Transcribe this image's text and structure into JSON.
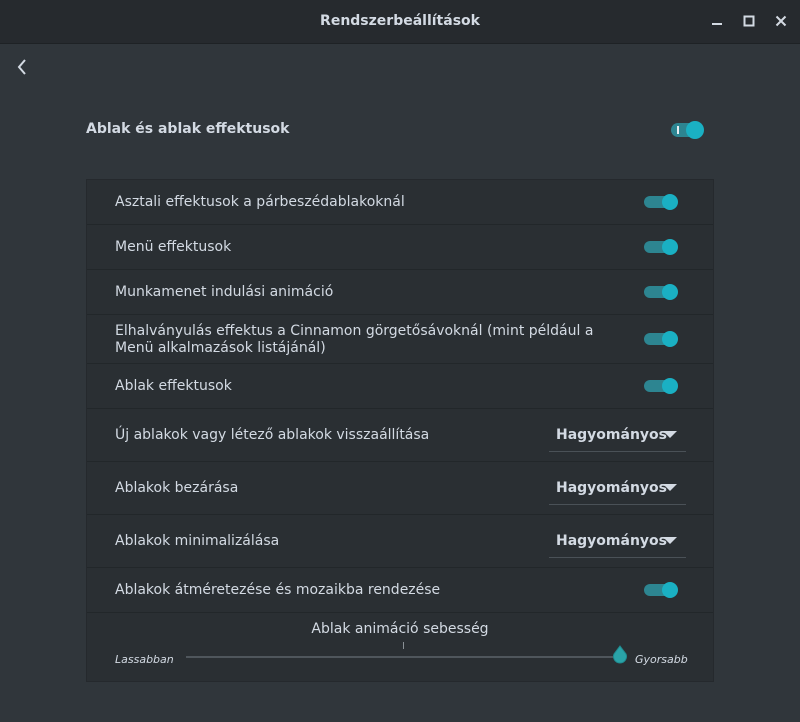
{
  "window": {
    "title": "Rendszerbeállítások"
  },
  "section": {
    "title": "Ablak és ablak effektusok",
    "enabled": true
  },
  "rows": [
    {
      "label": "Asztali effektusok a párbeszédablakoknál",
      "type": "switch",
      "on": true
    },
    {
      "label": "Menü effektusok",
      "type": "switch",
      "on": true
    },
    {
      "label": "Munkamenet indulási animáció",
      "type": "switch",
      "on": true
    },
    {
      "label": "Elhalványulás effektus a Cinnamon görgetősávoknál (mint például a Menü alkalmazások listájánál)",
      "type": "switch",
      "on": true
    },
    {
      "label": "Ablak effektusok",
      "type": "switch",
      "on": true
    },
    {
      "label": "Új ablakok vagy létező ablakok visszaállítása",
      "type": "dropdown",
      "value": "Hagyományos"
    },
    {
      "label": "Ablakok bezárása",
      "type": "dropdown",
      "value": "Hagyományos"
    },
    {
      "label": "Ablakok minimalizálása",
      "type": "dropdown",
      "value": "Hagyományos"
    },
    {
      "label": "Ablakok átméretezése és mozaikba rendezése",
      "type": "switch",
      "on": true
    }
  ],
  "slider": {
    "title": "Ablak animáció sebesség",
    "min_label": "Lassabban",
    "max_label": "Gyorsabb",
    "value_fraction": 1.0
  },
  "colors": {
    "accent": "#1ab0c3",
    "track": "#2d8591",
    "background": "#30363b",
    "panel": "#2a2f33",
    "titlebar": "#262a2e",
    "text": "#d3dae3"
  },
  "icons": {
    "back": "chevron-left-icon",
    "minimize": "minimize-icon",
    "maximize": "maximize-icon",
    "close": "close-icon"
  }
}
